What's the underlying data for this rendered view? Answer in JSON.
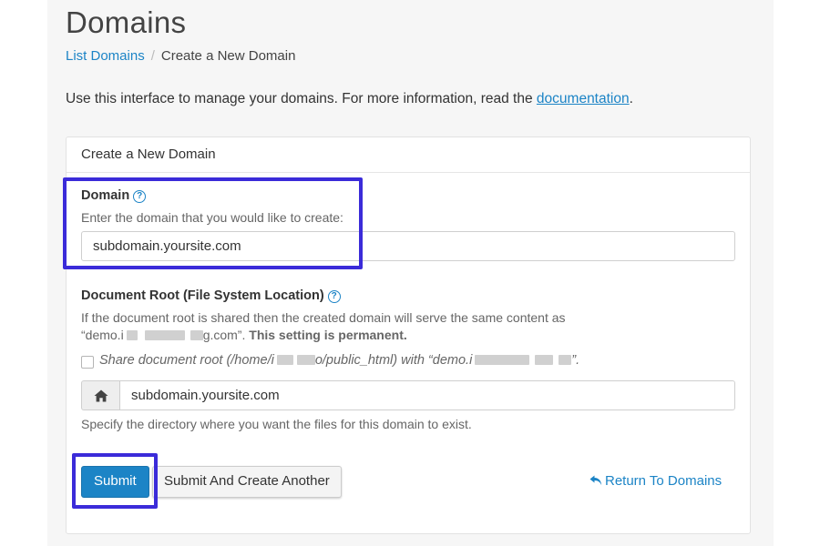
{
  "header": {
    "title": "Domains",
    "breadcrumb": {
      "link": "List Domains",
      "current": "Create a New Domain"
    }
  },
  "intro": {
    "text_before": "Use this interface to manage your domains. For more information, read the ",
    "link": "documentation",
    "text_after": "."
  },
  "panel": {
    "heading": "Create a New Domain",
    "domain": {
      "label": "Domain",
      "hint": "Enter the domain that you would like to create:",
      "value": "subdomain.yoursite.com"
    },
    "docroot": {
      "label": "Document Root (File System Location)",
      "desc_line1": "If the document root is shared then the created domain will serve the same content as",
      "desc_start": "“demo.i",
      "desc_mid": "g.com”. ",
      "desc_bold": "This setting is permanent.",
      "share_part1": "Share document root (/home/i",
      "share_part2": "o/public_html) with “demo.i",
      "share_part3": "”.",
      "share_checked": false,
      "value": "subdomain.yoursite.com",
      "hint": "Specify the directory where you want the files for this domain to exist."
    },
    "actions": {
      "submit": "Submit",
      "submit_another": "Submit And Create Another",
      "return": "Return To Domains"
    }
  },
  "colors": {
    "accent": "#1c84c6",
    "highlight": "#3b2bd9"
  },
  "icons": [
    "help-icon",
    "home-icon",
    "return-arrow-icon"
  ]
}
